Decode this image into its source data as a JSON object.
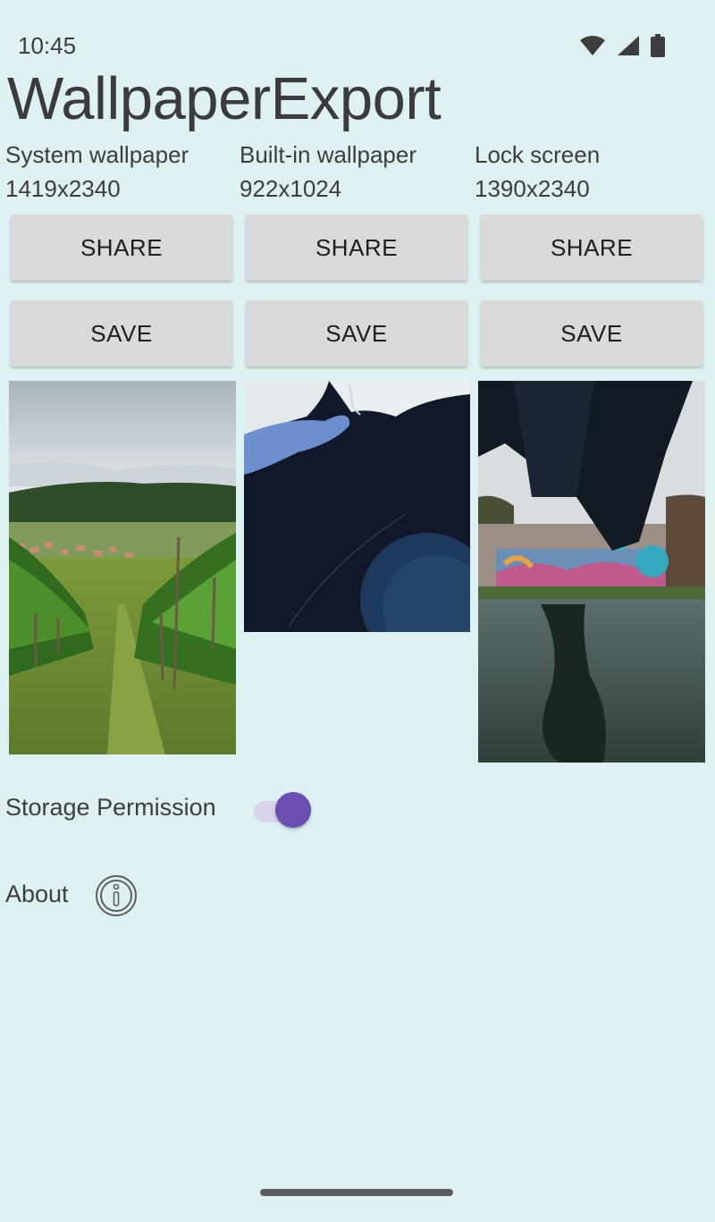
{
  "status_bar": {
    "time": "10:45",
    "icons": [
      "wifi-icon",
      "signal-icon",
      "battery-icon"
    ]
  },
  "app": {
    "title": "WallpaperExport"
  },
  "columns": [
    {
      "label": "System wallpaper",
      "size": "1419x2340",
      "share_label": "SHARE",
      "save_label": "SAVE"
    },
    {
      "label": "Built-in wallpaper",
      "size": "922x1024",
      "share_label": "SHARE",
      "save_label": "SAVE"
    },
    {
      "label": "Lock screen",
      "size": "1390x2340",
      "share_label": "SHARE",
      "save_label": "SAVE"
    }
  ],
  "settings": {
    "storage_permission": {
      "label": "Storage Permission",
      "enabled": true
    },
    "about": {
      "label": "About",
      "icon": "info-icon"
    }
  },
  "colors": {
    "background": "#ddf1f2",
    "button": "#d9d9d9",
    "switch_thumb": "#6a4fb0"
  }
}
